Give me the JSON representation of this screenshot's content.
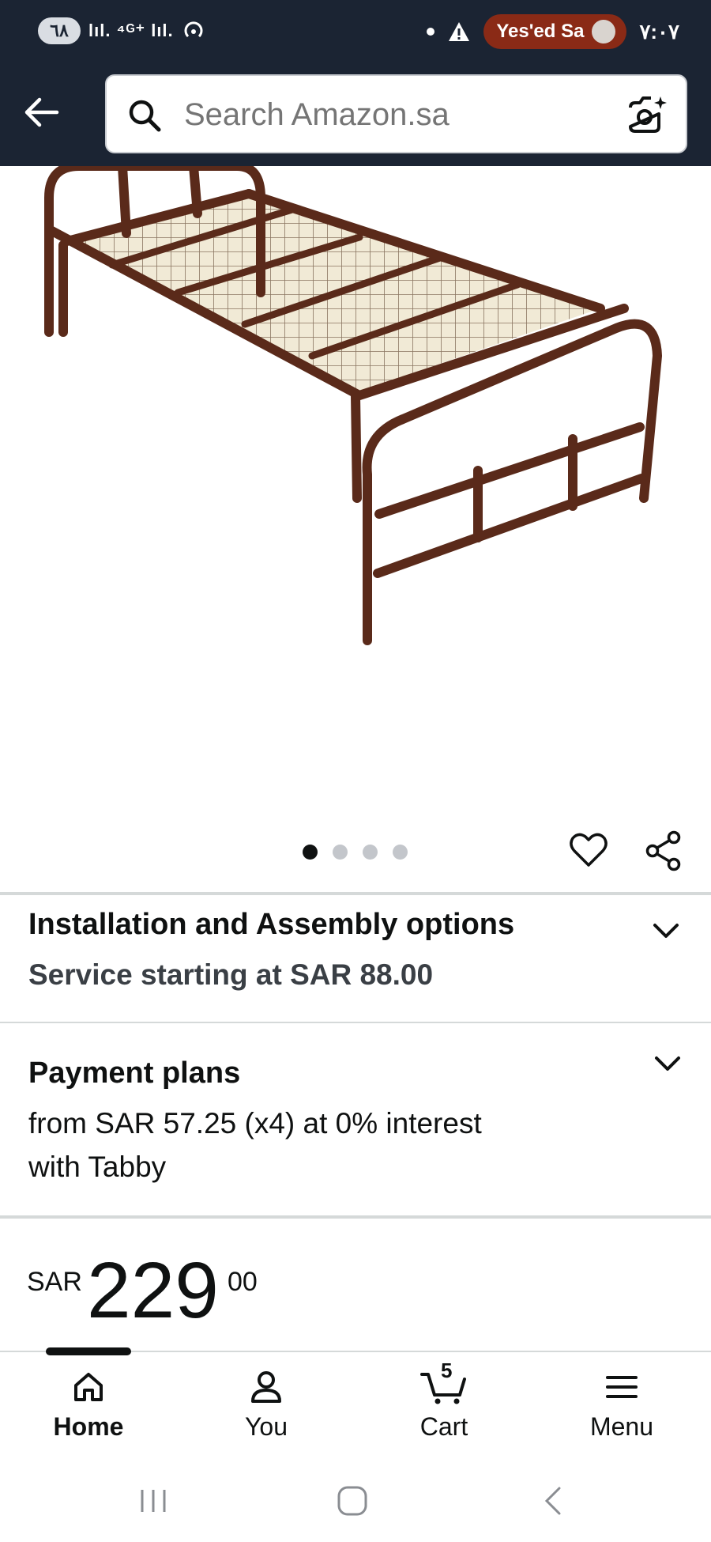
{
  "status_bar": {
    "left_badge": "٦٨",
    "signal_text": "lıl. ⁴ᴳ⁺ lıl.",
    "recording_label": "Yes'ed Sa",
    "time": "٧:٠٧"
  },
  "header": {
    "search_placeholder": "Search Amazon.sa",
    "back_icon": "arrow-left-icon",
    "search_icon": "search-icon",
    "camera_icon": "camera-search-icon"
  },
  "gallery": {
    "image_count": 4,
    "active_index": 0
  },
  "installation": {
    "title": "Installation and Assembly options",
    "subtitle": "Service starting at SAR 88.00"
  },
  "payment": {
    "title": "Payment plans",
    "line1": "from SAR 57.25 (x4) at 0% interest",
    "line2": "with Tabby"
  },
  "price": {
    "currency": "SAR",
    "whole": "229",
    "fraction": "00"
  },
  "bottom_nav": {
    "items": [
      {
        "label": "Home",
        "icon": "home-icon",
        "active": true
      },
      {
        "label": "You",
        "icon": "person-icon",
        "active": false
      },
      {
        "label": "Cart",
        "icon": "cart-icon",
        "active": false
      },
      {
        "label": "Menu",
        "icon": "menu-icon",
        "active": false
      }
    ],
    "cart_count": "5"
  },
  "colors": {
    "header_bg": "#1b2433",
    "recording_bg": "#8a2a16",
    "bed_frame": "#5a2a1a",
    "text": "#0f1111"
  }
}
